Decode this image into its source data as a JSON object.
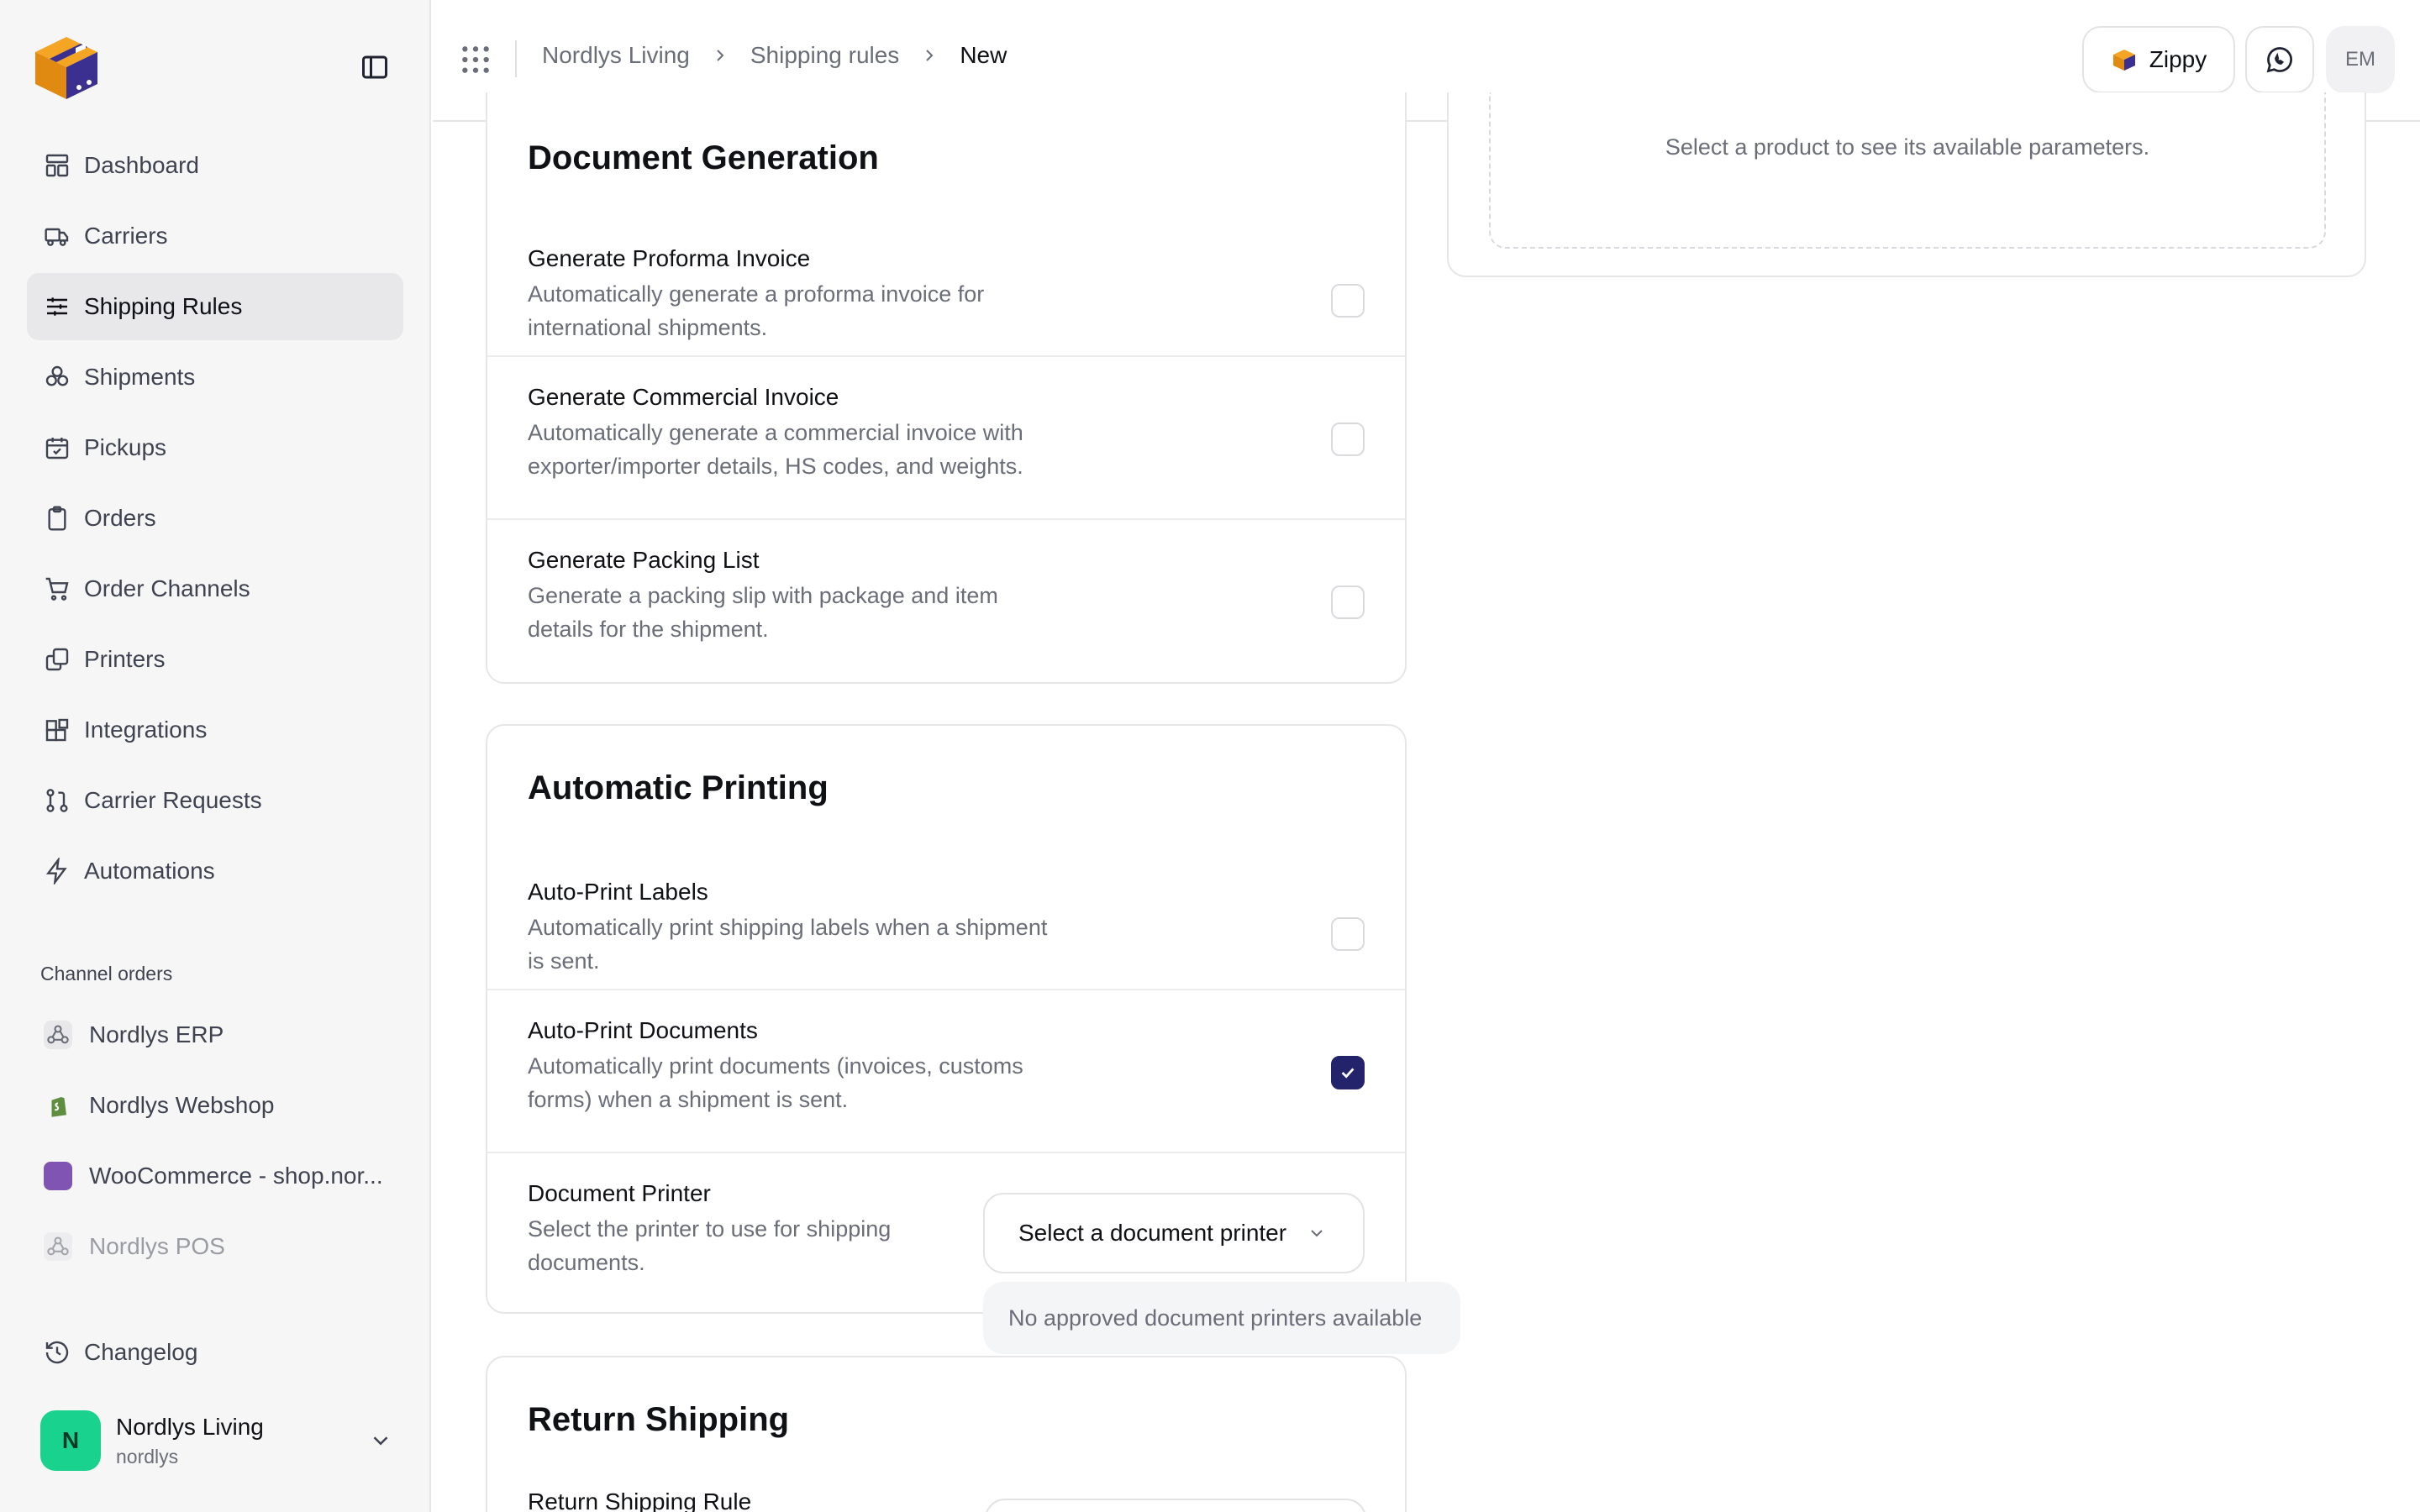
{
  "sidebar": {
    "nav": [
      {
        "label": "Dashboard",
        "icon": "dashboard-icon"
      },
      {
        "label": "Carriers",
        "icon": "truck-icon"
      },
      {
        "label": "Shipping Rules",
        "icon": "sliders-icon",
        "active": true
      },
      {
        "label": "Shipments",
        "icon": "boxes-icon"
      },
      {
        "label": "Pickups",
        "icon": "calendar-icon"
      },
      {
        "label": "Orders",
        "icon": "clipboard-icon"
      },
      {
        "label": "Order Channels",
        "icon": "cart-icon"
      },
      {
        "label": "Printers",
        "icon": "copy-icon"
      },
      {
        "label": "Integrations",
        "icon": "blocks-icon"
      },
      {
        "label": "Carrier Requests",
        "icon": "git-pull-icon"
      },
      {
        "label": "Automations",
        "icon": "bolt-icon"
      }
    ],
    "section_label": "Channel orders",
    "channels": [
      {
        "label": "Nordlys ERP",
        "icon": "webhook-icon"
      },
      {
        "label": "Nordlys Webshop",
        "icon": "shopify-icon"
      },
      {
        "label": "WooCommerce - shop.nor...",
        "icon": "woocommerce-icon"
      },
      {
        "label": "Nordlys POS",
        "icon": "webhook-icon"
      }
    ],
    "changelog": "Changelog",
    "account": {
      "initial": "N",
      "name": "Nordlys Living",
      "slug": "nordlys"
    }
  },
  "header": {
    "breadcrumb": [
      "Nordlys Living",
      "Shipping rules",
      "New"
    ],
    "zippy_label": "Zippy",
    "user_initials": "EM"
  },
  "right_panel": {
    "empty_text": "Select a product to see its available parameters."
  },
  "document_generation": {
    "title": "Document Generation",
    "rows": [
      {
        "title": "Generate Proforma Invoice",
        "desc": "Automatically generate a proforma invoice for international shipments.",
        "checked": false
      },
      {
        "title": "Generate Commercial Invoice",
        "desc": "Automatically generate a commercial invoice with exporter/importer details, HS codes, and weights.",
        "checked": false
      },
      {
        "title": "Generate Packing List",
        "desc": "Generate a packing slip with package and item details for the shipment.",
        "checked": false
      }
    ]
  },
  "automatic_printing": {
    "title": "Automatic Printing",
    "rows": [
      {
        "title": "Auto-Print Labels",
        "desc": "Automatically print shipping labels when a shipment is sent.",
        "checked": false
      },
      {
        "title": "Auto-Print Documents",
        "desc": "Automatically print documents (invoices, customs forms) when a shipment is sent.",
        "checked": true
      },
      {
        "title": "Document Printer",
        "desc": "Select the printer to use for shipping documents."
      }
    ],
    "printer_placeholder": "Select a document printer",
    "printer_hint": "No approved document printers available"
  },
  "return_shipping": {
    "title": "Return Shipping",
    "row_title": "Return Shipping Rule"
  },
  "colors": {
    "accent": "#23236b",
    "brand_orange": "#f5a524",
    "brand_purple": "#3b2f8f",
    "avatar_green": "#19d28e"
  }
}
